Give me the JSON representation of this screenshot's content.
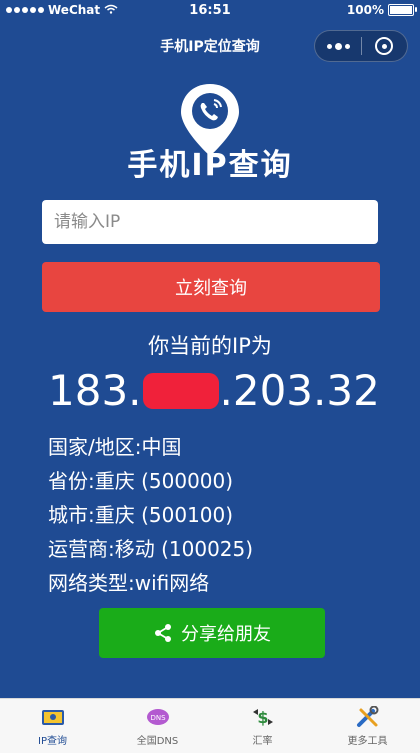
{
  "status_bar": {
    "carrier": "WeChat",
    "time": "16:51",
    "battery": "100%"
  },
  "nav": {
    "title": "手机IP定位查询"
  },
  "app": {
    "title": "手机IP查询"
  },
  "search": {
    "placeholder": "请输入IP",
    "button_label": "立刻查询"
  },
  "result": {
    "heading": "你当前的IP为",
    "ip_prefix": "183.",
    "ip_suffix": ".203.32",
    "country": "国家/地区:中国",
    "province": "省份:重庆 (500000)",
    "city": "城市:重庆 (500100)",
    "carrier": "运营商:移动 (100025)",
    "network": "网络类型:wifi网络"
  },
  "share": {
    "label": "分享给朋友"
  },
  "tabs": [
    {
      "label": "IP查询",
      "icon": "ip-query-icon",
      "active": true
    },
    {
      "label": "全国DNS",
      "icon": "dns-icon"
    },
    {
      "label": "汇率",
      "icon": "exchange-rate-icon"
    },
    {
      "label": "更多工具",
      "icon": "tools-icon"
    }
  ],
  "colors": {
    "background": "#1f4b93",
    "query_button": "#e84540",
    "share_button": "#1aac19",
    "redaction": "#f0213a"
  }
}
